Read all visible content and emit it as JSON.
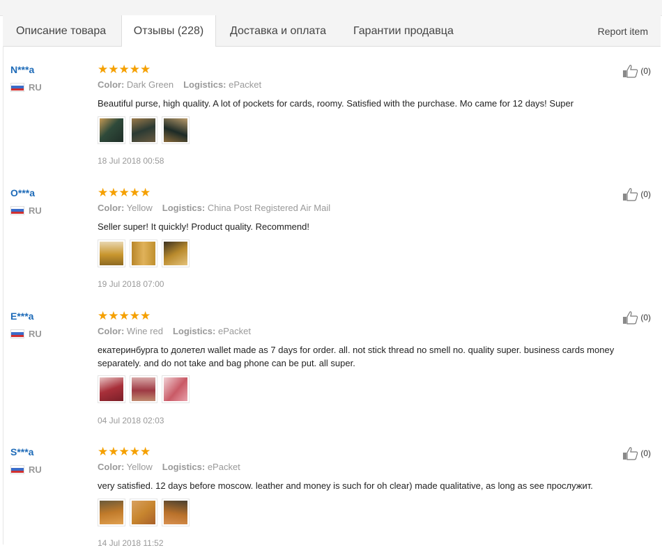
{
  "tabs": [
    {
      "label": "Описание товара"
    },
    {
      "label": "Отзывы (228)"
    },
    {
      "label": "Доставка и оплата"
    },
    {
      "label": "Гарантии продавца"
    }
  ],
  "report_label": "Report item",
  "labels": {
    "color": "Color:",
    "logistics": "Logistics:"
  },
  "reviews": [
    {
      "user": "N***a",
      "country": "RU",
      "stars": "★★★★★",
      "rating": 5,
      "color": "Dark Green",
      "logistics": "ePacket",
      "text": "Beautiful purse, high quality. A lot of pockets for cards, roomy. Satisfied with the purchase. Mo came for 12 days! Super",
      "date": "18 Jul 2018 00:58",
      "likes": "(0)",
      "photo_colors": [
        "#2f4a3a",
        "#2b3a33",
        "#1c2a26"
      ]
    },
    {
      "user": "O***a",
      "country": "RU",
      "stars": "★★★★★",
      "rating": 5,
      "color": "Yellow",
      "logistics": "China Post Registered Air Mail",
      "text": "Seller super! It quickly! Product quality. Recommend!",
      "date": "19 Jul 2018 07:00",
      "likes": "(0)",
      "photo_colors": [
        "#c9962e",
        "#d2a03a",
        "#b98a2c"
      ]
    },
    {
      "user": "E***a",
      "country": "RU",
      "stars": "★★★★★",
      "rating": 5,
      "color": "Wine red",
      "logistics": "ePacket",
      "text": "екатеринбурга to долетел wallet made as 7 days for order. all. not stick thread no smell no. quality super. business cards money separately. and do not take and bag phone can be put. all super.",
      "date": "04 Jul 2018 02:03",
      "likes": "(0)",
      "photo_colors": [
        "#a8303a",
        "#9e3a44",
        "#c95a66"
      ]
    },
    {
      "user": "S***a",
      "country": "RU",
      "stars": "★★★★★",
      "rating": 5,
      "color": "Yellow",
      "logistics": "ePacket",
      "text": "very satisfied. 12 days before moscow. leather and money is such for oh clear) made qualitative, as long as see прослужит.",
      "date": "14 Jul 2018 11:52",
      "likes": "(0)",
      "photo_colors": [
        "#c07a2a",
        "#c8862f",
        "#b9712a"
      ]
    }
  ]
}
